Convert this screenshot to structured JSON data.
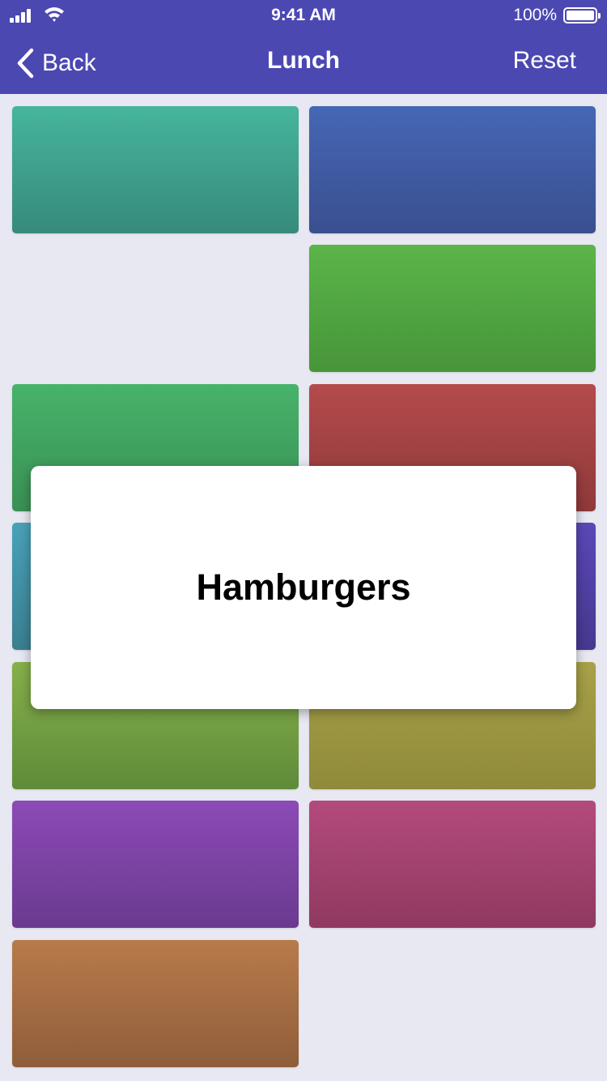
{
  "status_bar": {
    "time": "9:41 AM",
    "battery_percent": "100%",
    "icons": [
      "signal-icon",
      "wifi-icon",
      "battery-icon"
    ]
  },
  "nav": {
    "back_label": "Back",
    "title": "Lunch",
    "reset_label": "Reset",
    "back_icon": "chevron-left-icon"
  },
  "colors": {
    "nav_background": "#4b48b2",
    "page_background": "#e8e8f3",
    "tiles": [
      "#46b59c",
      "#4567b5",
      "#5bb549",
      "#47b36a",
      "#b44b4c",
      "#49a2b9",
      "#5b48b8",
      "#86b04a",
      "#a8a148",
      "#8c4ab6",
      "#b34a7c",
      "#b87b4a"
    ]
  },
  "popup": {
    "label": "Hamburgers"
  }
}
